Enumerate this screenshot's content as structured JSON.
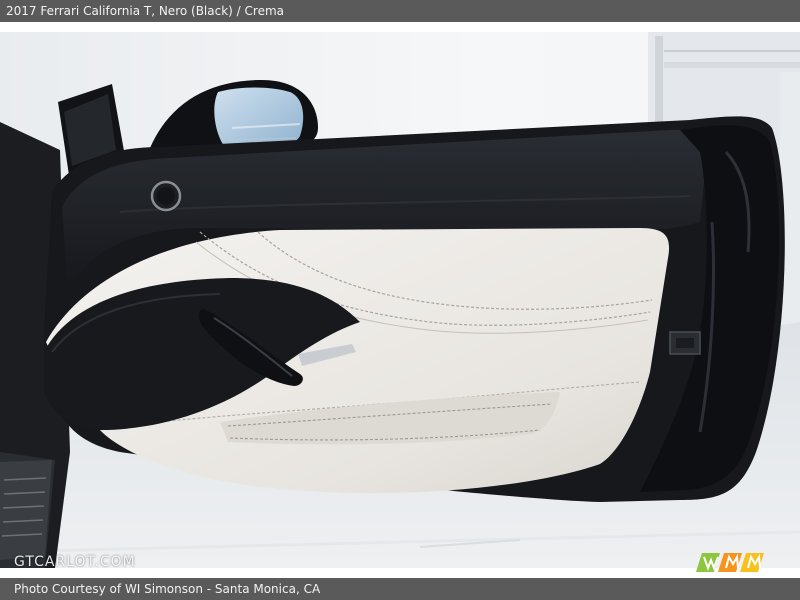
{
  "header": {
    "title": "2017 Ferrari California T,  Nero (Black) / Crema"
  },
  "watermark": {
    "text": "GTCARLOT.COM"
  },
  "footer": {
    "credit": "Photo Courtesy of WI Simonson - Santa Monica, CA"
  },
  "colors": {
    "bar_background": "#5a5a5a",
    "bar_text": "#f2f2f2",
    "interior_black": "#1a1c20",
    "interior_crema": "#ece9e4",
    "badge_green": "#8dc63f",
    "badge_orange": "#f7941d"
  },
  "photo": {
    "subject": "open driver door panel, black and crema leather",
    "icons": [
      "door-panel",
      "side-mirror",
      "door-handle",
      "speaker-grille",
      "door-latch"
    ]
  }
}
